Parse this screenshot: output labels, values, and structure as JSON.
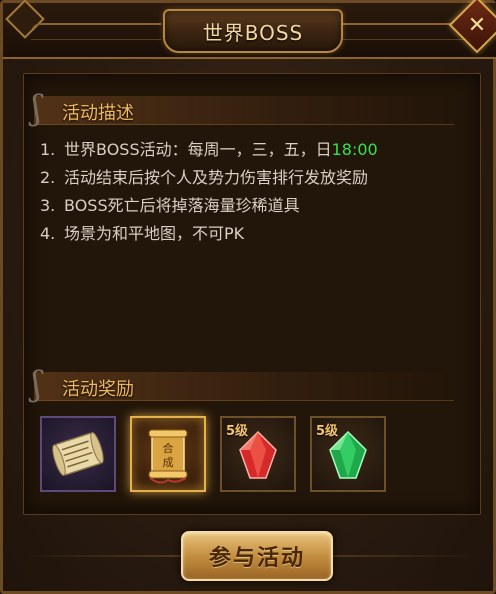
{
  "window": {
    "title": "世界BOSS",
    "close_icon": "close-x-icon"
  },
  "description": {
    "heading": "活动描述",
    "items": [
      {
        "num": "1.",
        "text": "世界BOSS活动：每周一，三，五，日",
        "highlight": "18:00"
      },
      {
        "num": "2.",
        "text": "活动结束后按个人及势力伤害排行发放奖励"
      },
      {
        "num": "3.",
        "text": "BOSS死亡后将掉落海量珍稀道具"
      },
      {
        "num": "4.",
        "text": "场景为和平地图，不可PK"
      }
    ]
  },
  "rewards": {
    "heading": "活动奖励",
    "items": [
      {
        "icon": "scroll-icon",
        "level": ""
      },
      {
        "icon": "synthesis-scroll-icon",
        "level": ""
      },
      {
        "icon": "red-gem-icon",
        "level": "5级"
      },
      {
        "icon": "green-gem-icon",
        "level": "5级"
      }
    ]
  },
  "actions": {
    "join_label": "参与活动"
  },
  "colors": {
    "highlight": "#36e24a",
    "heading": "#f0b95e",
    "button": "#c48e41"
  }
}
